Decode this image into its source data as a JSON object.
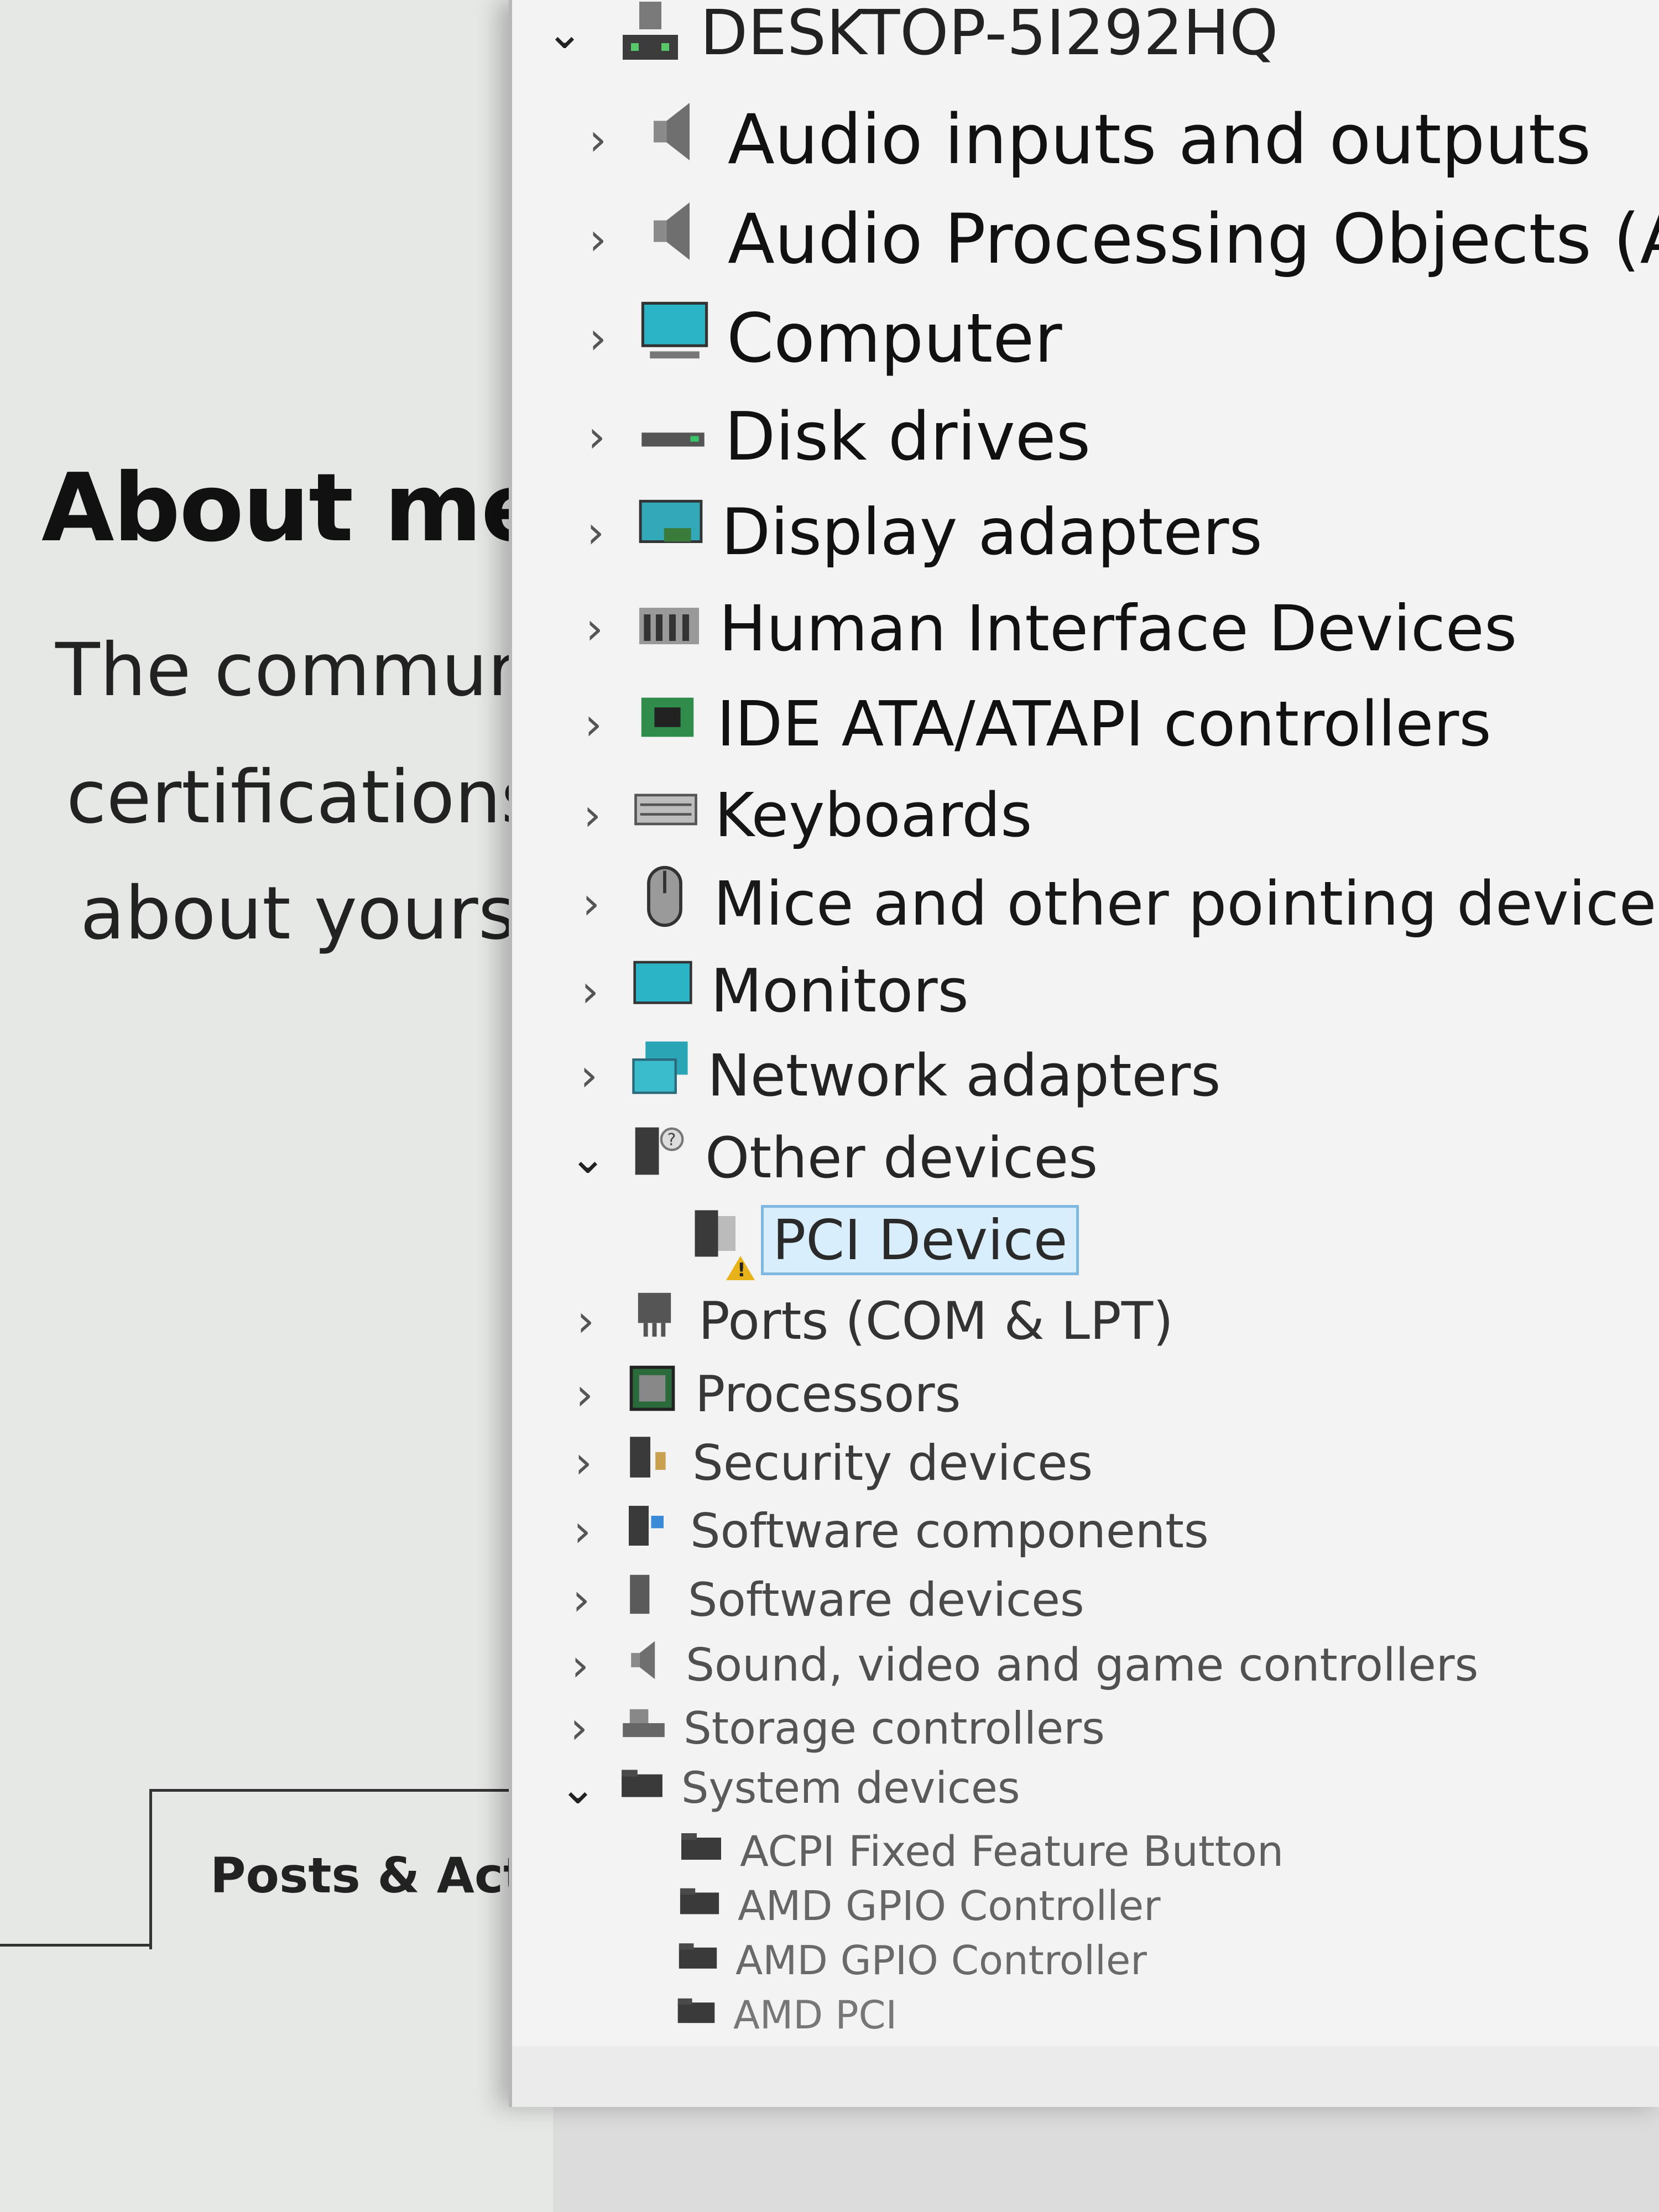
{
  "background_page": {
    "about_title": "About me:",
    "about_lines": [
      "The commur",
      "certifications",
      "about yourse"
    ],
    "posts_tab": "Posts & Act"
  },
  "device_manager": {
    "computer_name": "DESKTOP-5I292HQ",
    "categories": [
      {
        "label": "Audio inputs and outputs",
        "expanded": false,
        "icon": "speaker-icon"
      },
      {
        "label": "Audio Processing Objects (A",
        "expanded": false,
        "icon": "speaker-icon"
      },
      {
        "label": "Computer",
        "expanded": false,
        "icon": "computer-icon"
      },
      {
        "label": "Disk drives",
        "expanded": false,
        "icon": "disk-drive-icon"
      },
      {
        "label": "Display adapters",
        "expanded": false,
        "icon": "display-adapter-icon"
      },
      {
        "label": "Human Interface Devices",
        "expanded": false,
        "icon": "hid-icon"
      },
      {
        "label": "IDE ATA/ATAPI controllers",
        "expanded": false,
        "icon": "ide-controller-icon"
      },
      {
        "label": "Keyboards",
        "expanded": false,
        "icon": "keyboard-icon"
      },
      {
        "label": "Mice and other pointing devices",
        "expanded": false,
        "icon": "mouse-icon"
      },
      {
        "label": "Monitors",
        "expanded": false,
        "icon": "monitor-icon"
      },
      {
        "label": "Network adapters",
        "expanded": false,
        "icon": "network-adapter-icon"
      },
      {
        "label": "Other devices",
        "expanded": true,
        "icon": "unknown-device-icon",
        "children": [
          {
            "label": "PCI Device",
            "selected": true,
            "warning": true,
            "icon": "warning-device-icon"
          }
        ]
      },
      {
        "label": "Ports (COM & LPT)",
        "expanded": false,
        "icon": "port-icon"
      },
      {
        "label": "Processors",
        "expanded": false,
        "icon": "processor-icon"
      },
      {
        "label": "Security devices",
        "expanded": false,
        "icon": "security-device-icon"
      },
      {
        "label": "Software components",
        "expanded": false,
        "icon": "software-component-icon"
      },
      {
        "label": "Software devices",
        "expanded": false,
        "icon": "software-device-icon"
      },
      {
        "label": "Sound, video and game controllers",
        "expanded": false,
        "icon": "speaker-icon"
      },
      {
        "label": "Storage controllers",
        "expanded": false,
        "icon": "storage-controller-icon"
      },
      {
        "label": "System devices",
        "expanded": true,
        "icon": "folder-icon",
        "children": [
          {
            "label": "ACPI Fixed Feature Button",
            "icon": "folder-icon"
          },
          {
            "label": "AMD GPIO Controller",
            "icon": "folder-icon"
          },
          {
            "label": "AMD GPIO Controller",
            "icon": "folder-icon"
          },
          {
            "label": "AMD PCI",
            "icon": "folder-icon"
          }
        ]
      }
    ]
  }
}
